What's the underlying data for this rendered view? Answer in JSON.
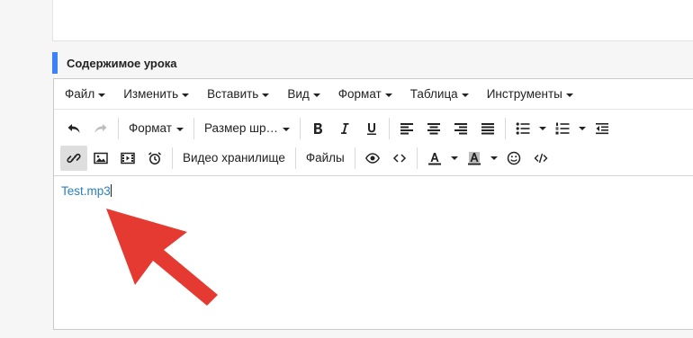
{
  "section": {
    "title": "Содержимое урока",
    "accent": "#3b82f6"
  },
  "menubar": {
    "items": [
      {
        "label": "Файл"
      },
      {
        "label": "Изменить"
      },
      {
        "label": "Вставить"
      },
      {
        "label": "Вид"
      },
      {
        "label": "Формат"
      },
      {
        "label": "Таблица"
      },
      {
        "label": "Инструменты"
      }
    ]
  },
  "toolbar": {
    "format_label": "Формат",
    "font_size_label": "Размер шр…",
    "video_storage_label": "Видео хранилище",
    "files_label": "Файлы",
    "icons": [
      "undo-icon",
      "redo-icon",
      "bold-icon",
      "italic-icon",
      "underline-icon",
      "align-left-icon",
      "align-center-icon",
      "align-right-icon",
      "align-justify-icon",
      "bullet-list-icon",
      "numbered-list-icon",
      "outdent-icon",
      "link-icon",
      "image-icon",
      "media-icon",
      "alarm-icon",
      "preview-icon",
      "code-icon",
      "text-color-icon",
      "background-color-icon",
      "emoticon-icon",
      "source-code-icon"
    ]
  },
  "content": {
    "text": "Test.mp3",
    "link_color": "#2a7fbe"
  },
  "annotation": {
    "arrow_color": "#e53a32"
  }
}
